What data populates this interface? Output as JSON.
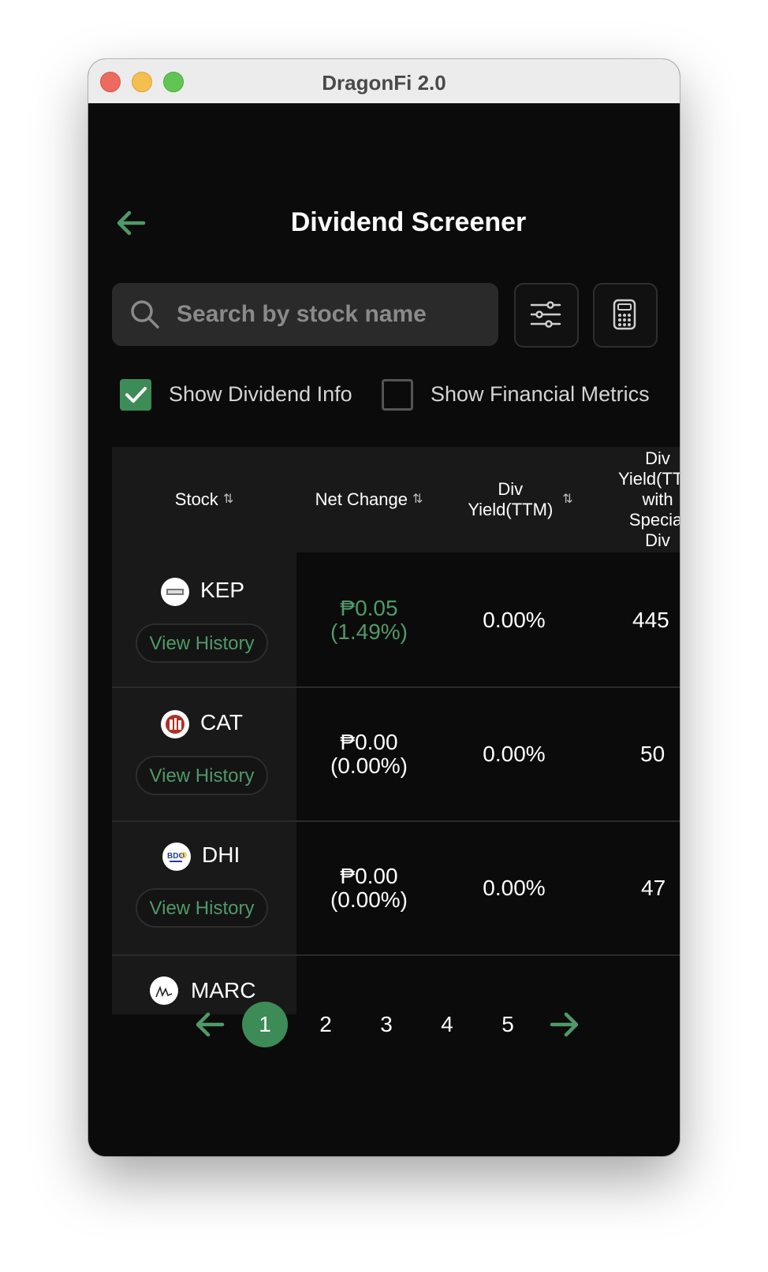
{
  "window": {
    "title": "DragonFi 2.0"
  },
  "header": {
    "title": "Dividend Screener"
  },
  "search": {
    "placeholder": "Search by stock name"
  },
  "toggles": [
    {
      "label": "Show Dividend Info",
      "checked": true
    },
    {
      "label": "Show Financial Metrics",
      "checked": false
    }
  ],
  "table": {
    "columns": [
      "Stock",
      "Net Change",
      "Div Yield(TTM)",
      "Div Yield(TTM) with Special Div"
    ],
    "rows": [
      {
        "ticker": "KEP",
        "view": "View History",
        "net": "₱0.05",
        "pct": "(1.49%)",
        "yield": "0.00%",
        "extra": "445",
        "positive": true
      },
      {
        "ticker": "CAT",
        "view": "View History",
        "net": "₱0.00",
        "pct": "(0.00%)",
        "yield": "0.00%",
        "extra": "50",
        "positive": false
      },
      {
        "ticker": "DHI",
        "view": "View History",
        "net": "₱0.00",
        "pct": "(0.00%)",
        "yield": "0.00%",
        "extra": "47",
        "positive": false
      },
      {
        "ticker": "MARC"
      }
    ]
  },
  "pagination": {
    "pages": [
      "1",
      "2",
      "3",
      "4",
      "5"
    ],
    "active": "1"
  },
  "colors": {
    "accent": "#3d8b57",
    "positive": "#4f9a68",
    "background": "#0b0b0b"
  }
}
